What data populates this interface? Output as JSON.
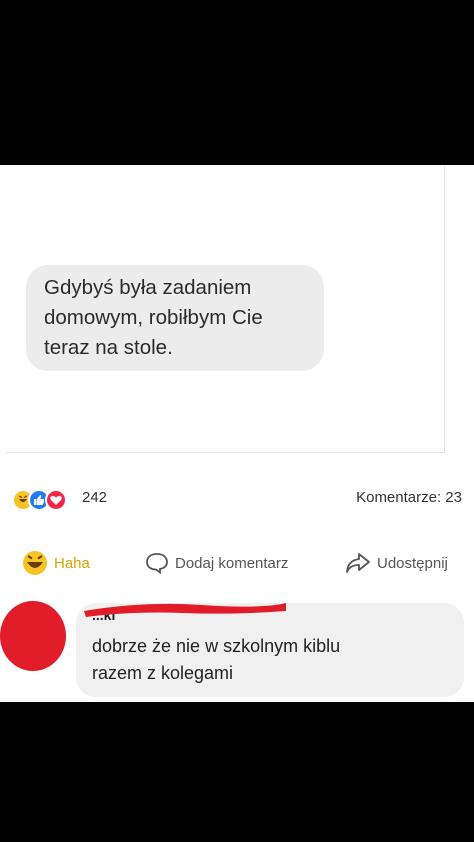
{
  "post": {
    "message_line1": "Gdybyś była zadaniem",
    "message_line2": "domowym, robiłbym Cie",
    "message_line3": "teraz na stole."
  },
  "stats": {
    "reactions_count": "242",
    "comments_label": "Komentarze: 23"
  },
  "actions": {
    "haha_label": "Haha",
    "comment_label": "Dodaj komentarz",
    "share_label": "Udostępnij"
  },
  "comment": {
    "author_fragment": "...ki",
    "text_line1": "dobrze że nie w szkolnym kiblu",
    "text_line2": "razem z kolegami"
  },
  "colors": {
    "haha": "#f7c425",
    "like": "#1f7bf2",
    "love": "#f0284a",
    "redaction": "#e11d2a"
  }
}
